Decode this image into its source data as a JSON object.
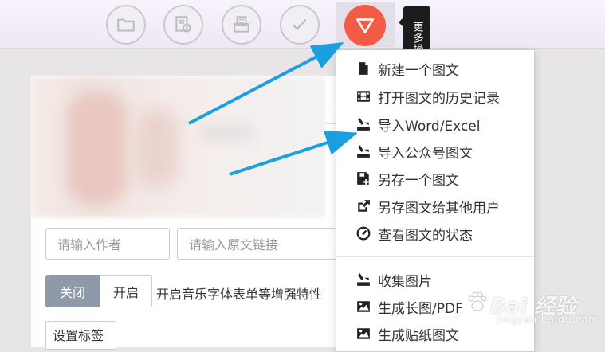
{
  "toolbar": {
    "buttons": [
      {
        "icon": "folder-icon"
      },
      {
        "icon": "preview-icon"
      },
      {
        "icon": "print-icon"
      },
      {
        "icon": "check-icon"
      }
    ],
    "more_button_icon": "triangle-down-icon",
    "more_color": "#f25c45",
    "tooltip": "更多操作"
  },
  "editor": {
    "author_placeholder": "请输入作者",
    "source_placeholder": "请输入原文链接",
    "toggle_on_label": "关闭",
    "toggle_off_label": "开启",
    "toggle_desc": "开启音乐字体表单等增强特性",
    "tag_button": "设置标签"
  },
  "menu": {
    "items": [
      {
        "icon": "file-icon",
        "label": "新建一个图文"
      },
      {
        "icon": "film-icon",
        "label": "打开图文的历史记录"
      },
      {
        "icon": "import-icon",
        "label": "导入Word/Excel"
      },
      {
        "icon": "import-icon",
        "label": "导入公众号图文"
      },
      {
        "icon": "save-icon",
        "label": "另存一个图文"
      },
      {
        "icon": "share-icon",
        "label": "另存图文给其他用户"
      },
      {
        "icon": "dashboard-icon",
        "label": "查看图文的状态"
      }
    ],
    "items2": [
      {
        "icon": "import-icon",
        "label": "收集图片"
      },
      {
        "icon": "image-icon",
        "label": "生成长图/PDF"
      },
      {
        "icon": "image-icon",
        "label": "生成贴纸图文"
      }
    ]
  },
  "watermark": {
    "brand": "Bai 经验",
    "sub": "jingyan.baidu.com"
  },
  "colors": {
    "arrow": "#1a9fe0",
    "toggle_active": "#8e9aa9"
  }
}
